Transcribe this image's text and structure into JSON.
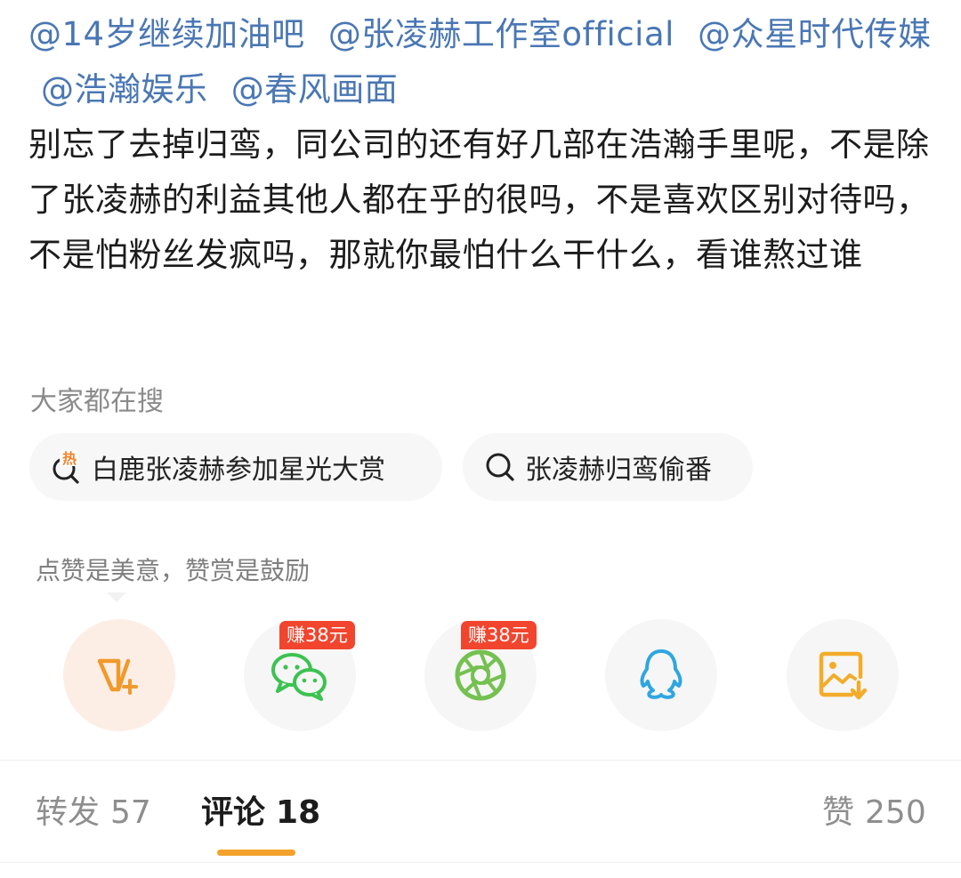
{
  "post": {
    "mentions": [
      "@14岁继续加油吧",
      "@张凌赫工作室official",
      "@众星时代传媒",
      "@浩瀚娱乐",
      "@春风画面"
    ],
    "paragraph": "别忘了去掉归鸾，同公司的还有好几部在浩瀚手里呢，不是除了张凌赫的利益其他人都在乎的很吗，不是喜欢区别对待吗，不是怕粉丝发疯吗，那就你最怕什么干什么，看谁熬过谁"
  },
  "hot_search": {
    "title": "大家都在搜",
    "chips": [
      {
        "label": "白鹿张凌赫参加星光大赏",
        "icon": "hot-search-icon",
        "hot_tag": "热"
      },
      {
        "label": "张凌赫归鸾偷番",
        "icon": "search-icon"
      }
    ]
  },
  "reward": {
    "hint": "点赞是美意，赞赏是鼓励"
  },
  "share": {
    "buttons": [
      {
        "name": "vip-plus",
        "icon": "v-plus-icon",
        "color": "#f09a2c"
      },
      {
        "name": "wechat",
        "icon": "wechat-icon",
        "color": "#3cc251",
        "badge": "赚38元"
      },
      {
        "name": "moments",
        "icon": "aperture-icon",
        "color": "#74c151",
        "badge": "赚38元"
      },
      {
        "name": "qq",
        "icon": "qq-penguin-icon",
        "color": "#2fa6e0"
      },
      {
        "name": "save-image",
        "icon": "save-image-icon",
        "color": "#f3ac2a"
      }
    ]
  },
  "tabs": [
    {
      "label": "转发",
      "count": "57",
      "active": false
    },
    {
      "label": "评论",
      "count": "18",
      "active": true
    },
    {
      "label": "赞",
      "count": "250",
      "active": false
    }
  ],
  "colors": {
    "mention": "#4a77b4",
    "accent_underline": "#f3a12b",
    "badge": "#f2452e"
  }
}
